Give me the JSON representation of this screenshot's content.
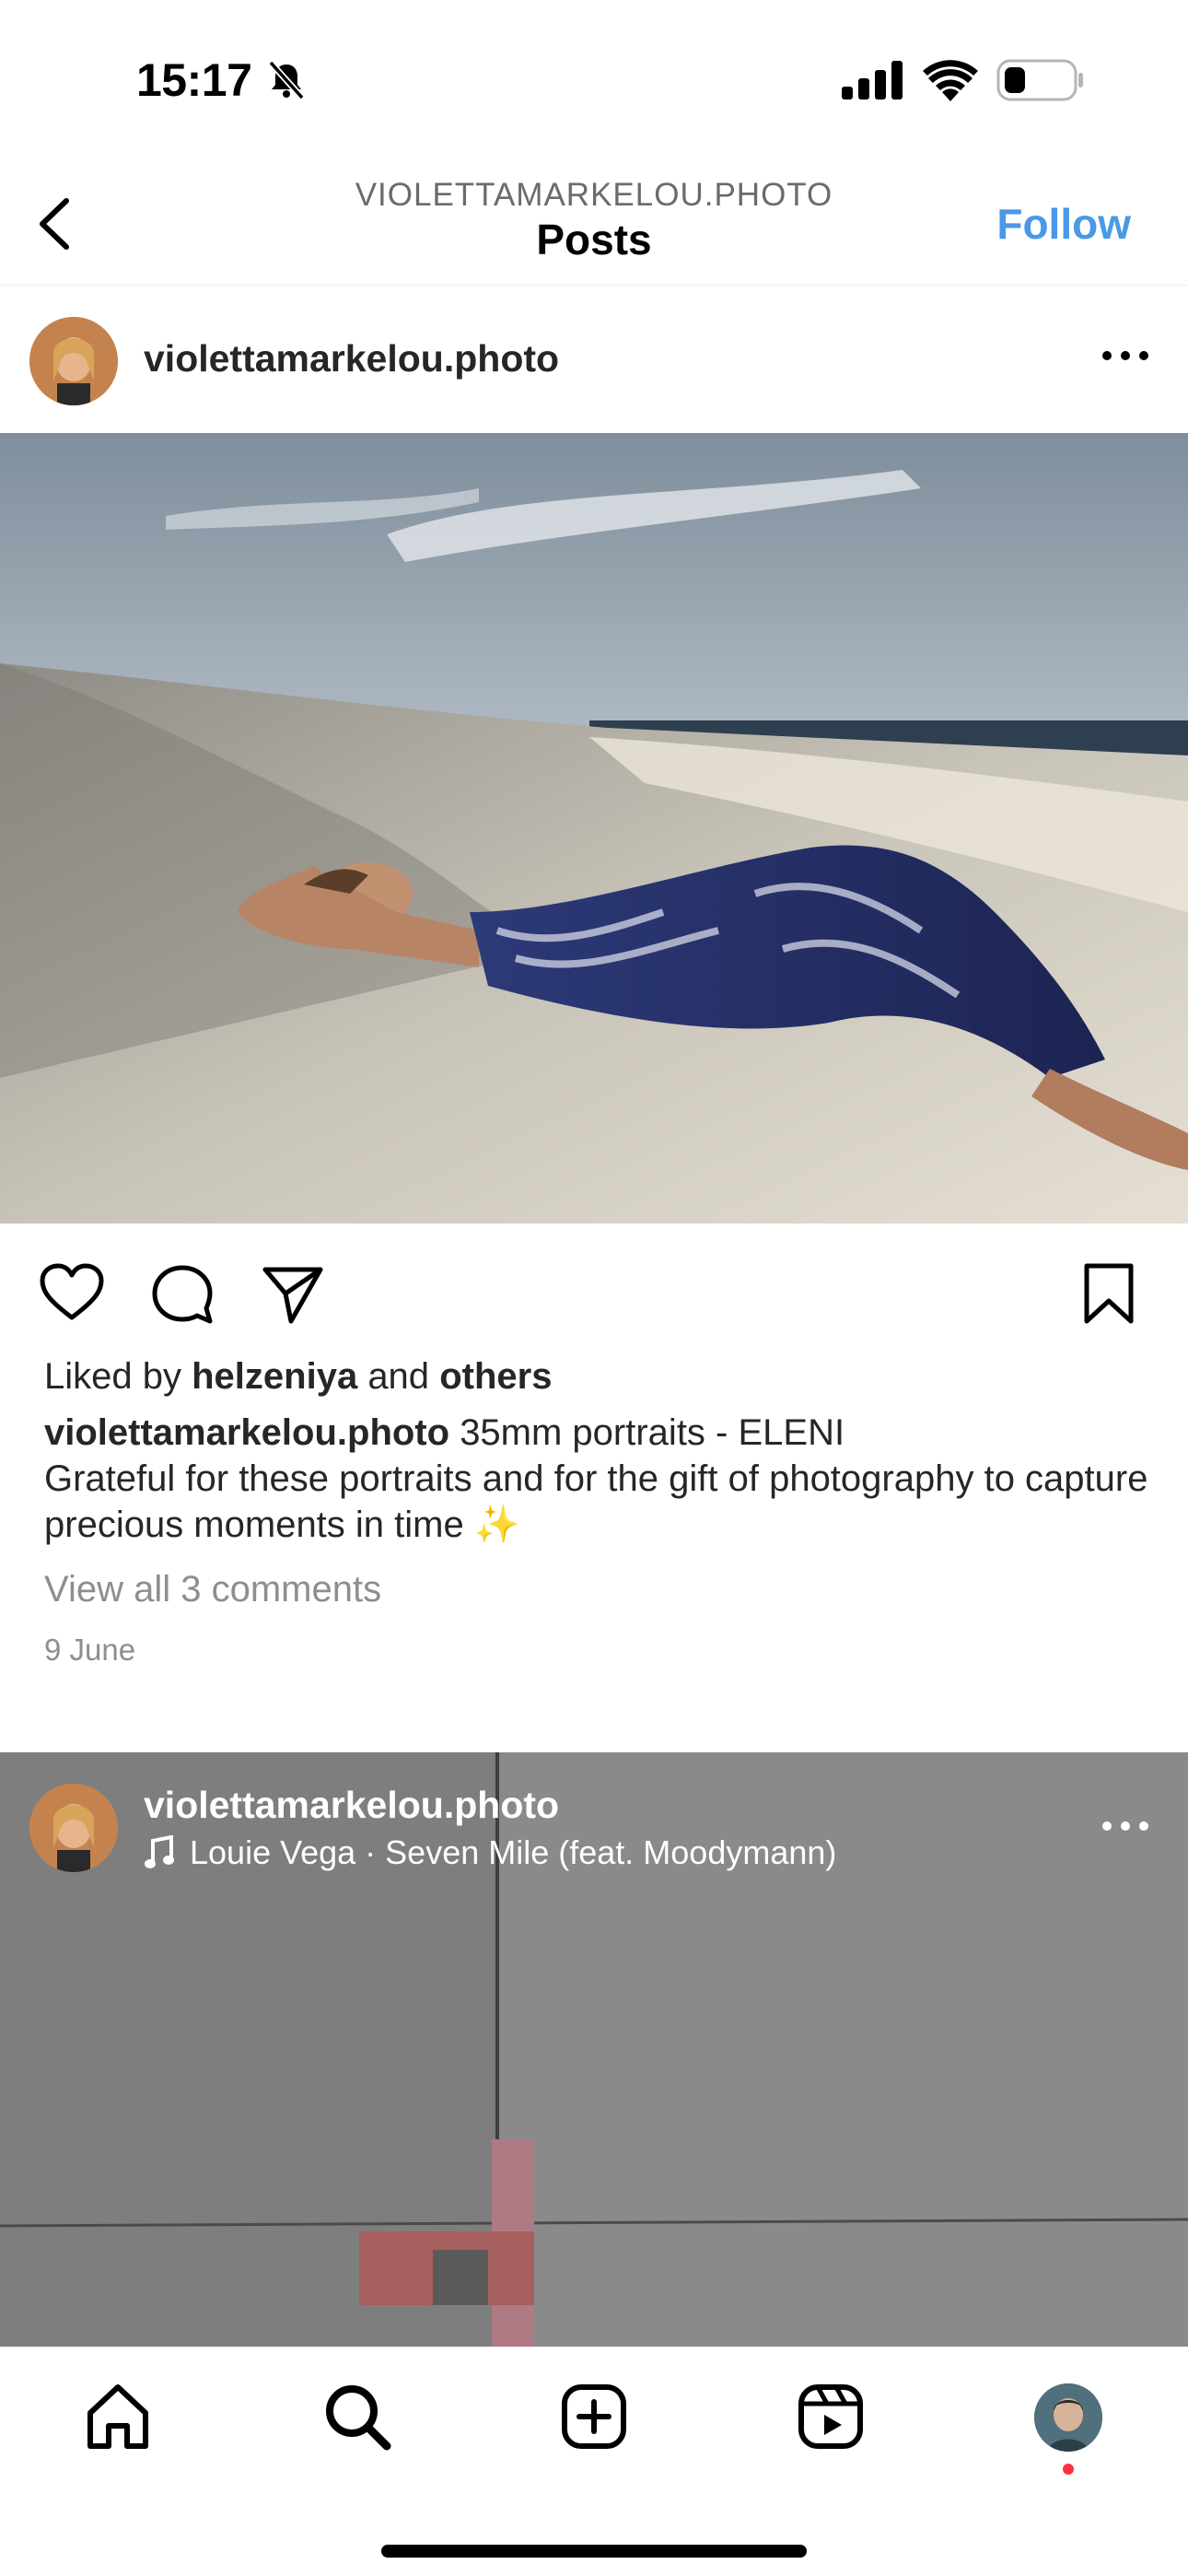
{
  "status_bar": {
    "time": "15:17",
    "icons": [
      "bell-slash-icon",
      "signal-icon",
      "wifi-icon",
      "battery-icon"
    ]
  },
  "header": {
    "subtitle": "VIOLETTAMARKELOU.PHOTO",
    "title": "Posts",
    "follow_label": "Follow",
    "accent_color": "#4a98e6"
  },
  "post1": {
    "username": "violettamarkelou.photo",
    "image_description_icon": "photo",
    "liked_prefix": "Liked by",
    "liked_user": "helzeniya",
    "liked_and": "and",
    "liked_others": "others",
    "caption_user": "violettamarkelou.photo",
    "caption_line1": "35mm portraits - ELENI",
    "caption_line2": "Grateful for these portraits and for the gift of photography to capture precious moments in time ✨",
    "comments_link": "View all 3 comments",
    "date": "9 June"
  },
  "post2": {
    "username": "violettamarkelou.photo",
    "music": "Louie Vega · Seven Mile (feat. Moodymann)"
  },
  "nav": {
    "items": [
      "home-icon",
      "search-icon",
      "create-icon",
      "reels-icon",
      "profile-avatar"
    ],
    "notification_color": "#ff3040"
  }
}
